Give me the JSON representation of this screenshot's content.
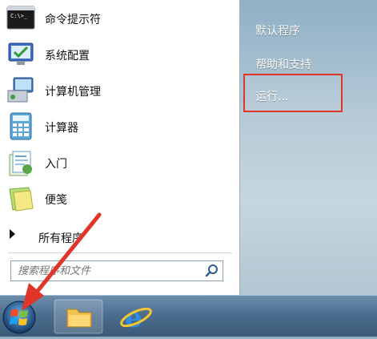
{
  "start_menu": {
    "programs": [
      {
        "label": "命令提示符",
        "icon": "cmd-icon"
      },
      {
        "label": "系统配置",
        "icon": "system-config-icon"
      },
      {
        "label": "计算机管理",
        "icon": "computer-management-icon"
      },
      {
        "label": "计算器",
        "icon": "calculator-icon"
      },
      {
        "label": "入门",
        "icon": "getting-started-icon"
      },
      {
        "label": "便笺",
        "icon": "sticky-notes-icon"
      }
    ],
    "all_programs_label": "所有程序",
    "search": {
      "placeholder": "搜索程序和文件"
    },
    "right_items": [
      {
        "label": "默认程序"
      },
      {
        "label": "帮助和支持"
      },
      {
        "label": "运行..."
      }
    ]
  },
  "taskbar": {
    "buttons": [
      {
        "icon": "windows-explorer-icon"
      },
      {
        "icon": "internet-explorer-icon"
      }
    ]
  },
  "colors": {
    "highlight_border": "#e0362a",
    "pointer_arrow": "#e0362a",
    "right_panel_text": "#ffffff"
  }
}
